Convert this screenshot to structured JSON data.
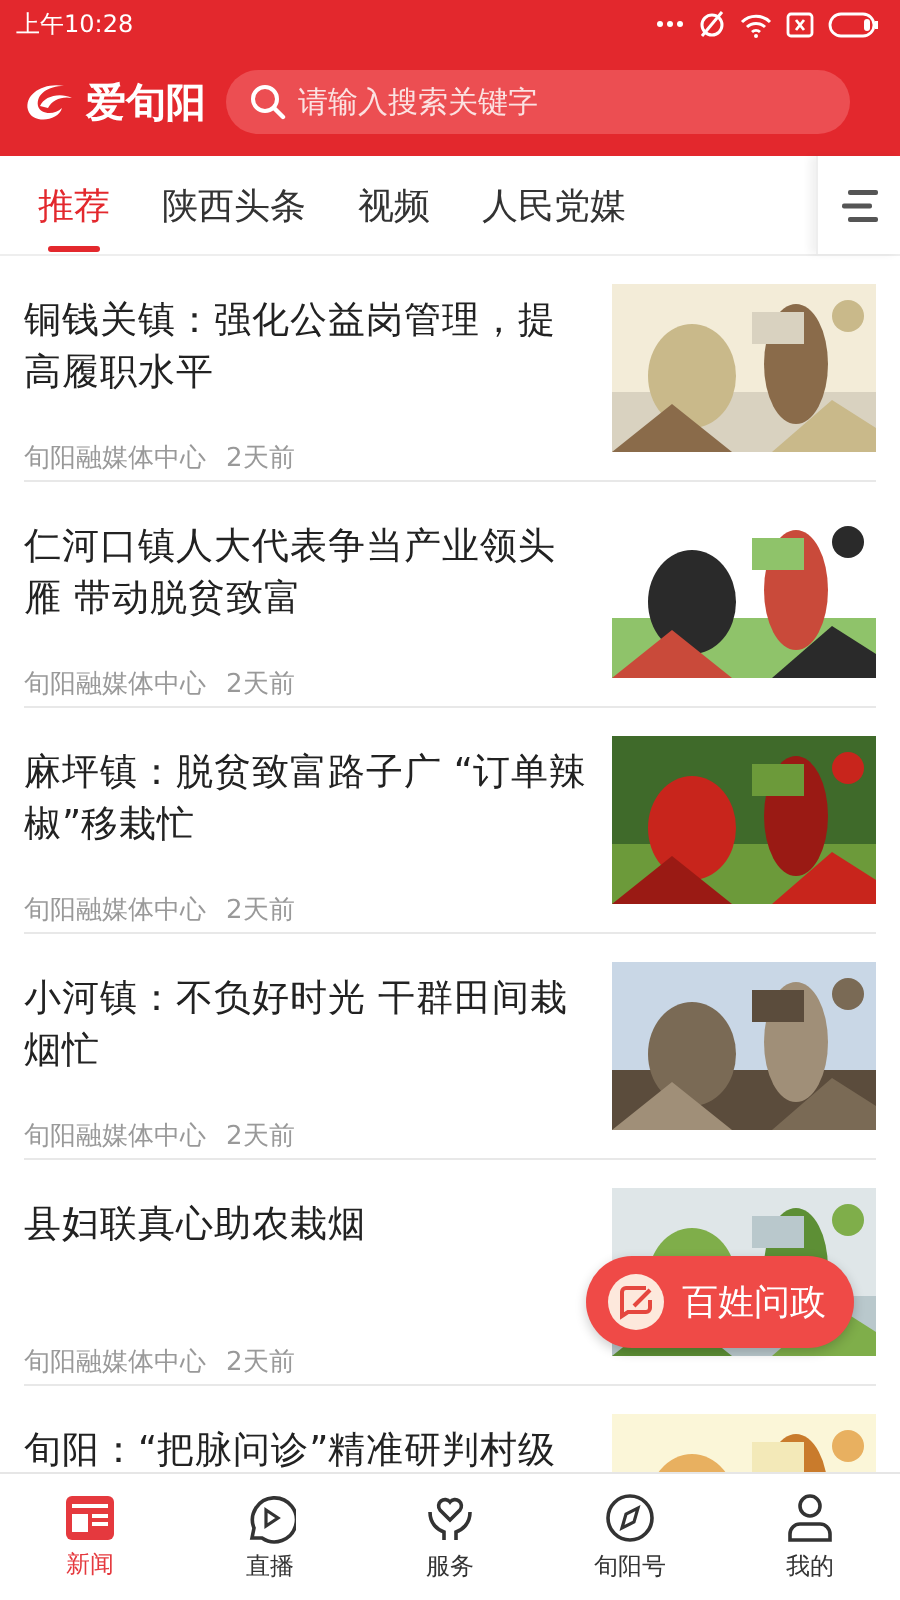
{
  "status_bar": {
    "time": "上午10:28"
  },
  "header": {
    "logo": "爱旬阳",
    "search": {
      "placeholder": "请输入搜索关键字"
    }
  },
  "tabs": [
    {
      "label": "推荐",
      "selected": true
    },
    {
      "label": "陕西头条",
      "selected": false
    },
    {
      "label": "视频",
      "selected": false
    },
    {
      "label": "人民党媒",
      "selected": false
    }
  ],
  "articles": [
    {
      "title": "铜钱关镇：强化公益岗管理，提高履职水平",
      "source": "旬阳融媒体中心",
      "time": "2天前"
    },
    {
      "title": "仁河口镇人大代表争当产业领头雁 带动脱贫致富",
      "source": "旬阳融媒体中心",
      "time": "2天前"
    },
    {
      "title": "麻坪镇：脱贫致富路子广 “订单辣椒”移栽忙",
      "source": "旬阳融媒体中心",
      "time": "2天前"
    },
    {
      "title": "小河镇：不负好时光 干群田间栽烟忙",
      "source": "旬阳融媒体中心",
      "time": "2天前"
    },
    {
      "title": "县妇联真心助农栽烟",
      "source": "旬阳融媒体中心",
      "time": "2天前"
    },
    {
      "title": "旬阳：“把脉问诊”精准研判村级"
    }
  ],
  "floating_button": {
    "label": "百姓问政"
  },
  "bottom_nav": [
    {
      "label": "新闻",
      "selected": true
    },
    {
      "label": "直播",
      "selected": false
    },
    {
      "label": "服务",
      "selected": false
    },
    {
      "label": "旬阳号",
      "selected": false
    },
    {
      "label": "我的",
      "selected": false
    }
  ]
}
